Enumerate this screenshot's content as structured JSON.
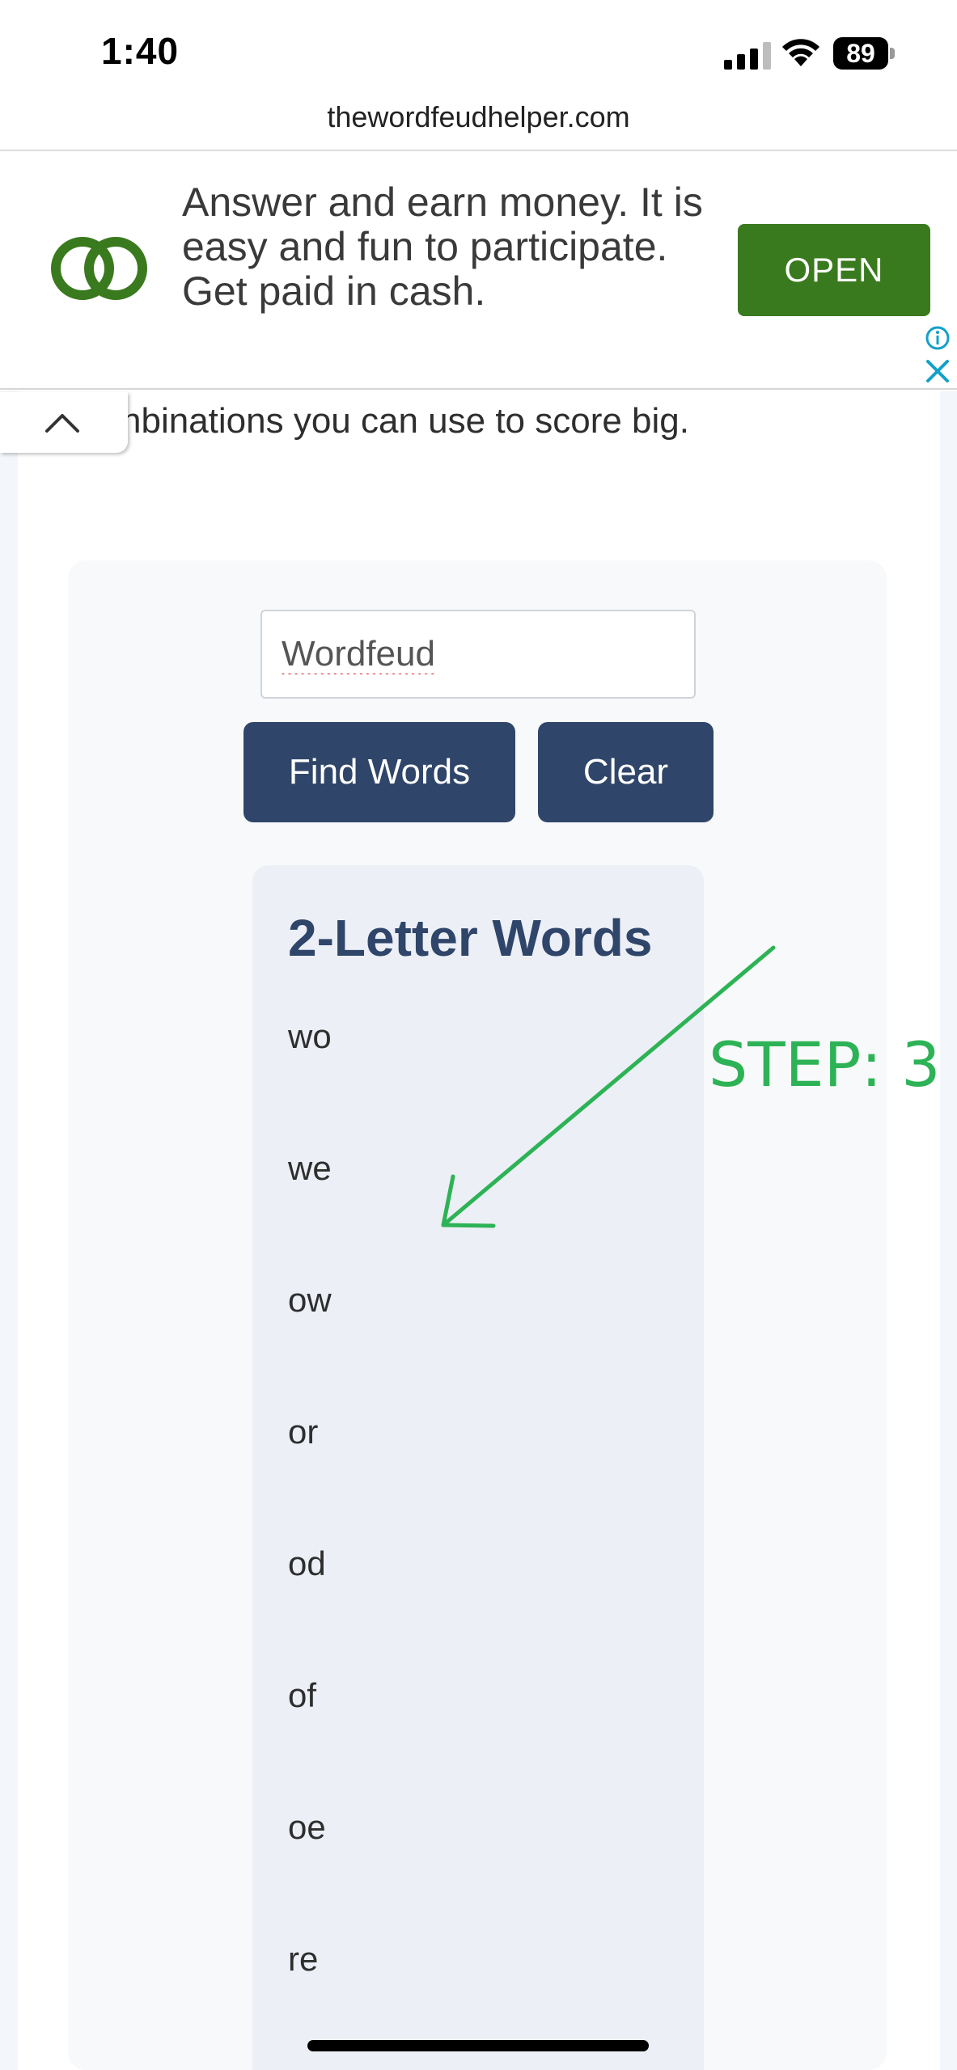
{
  "status_bar": {
    "time": "1:40",
    "battery": "89"
  },
  "browser": {
    "url": "thewordfeudhelper.com"
  },
  "ad": {
    "text": "Answer and earn money. It is easy and fun to participate. Get paid in cash.",
    "open_label": "OPEN",
    "logo_color": "#3a7a1e",
    "info_icon": "info-icon",
    "close_icon": "close-icon"
  },
  "page": {
    "intro_text": "nbinations you can use to score big."
  },
  "tool": {
    "input_value": "Wordfeud",
    "find_label": "Find Words",
    "clear_label": "Clear",
    "accent_color": "#2f4569"
  },
  "results": {
    "title": "2-Letter Words",
    "words": [
      "wo",
      "we",
      "ow",
      "or",
      "od",
      "of",
      "oe",
      "re"
    ]
  },
  "annotation": {
    "step_label": "STEP: 3",
    "color": "#2db356"
  }
}
